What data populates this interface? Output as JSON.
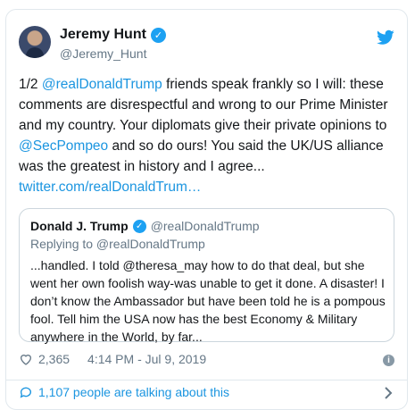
{
  "author": {
    "display_name": "Jeremy Hunt",
    "handle": "@Jeremy_Hunt"
  },
  "tweet": {
    "prefix": "1/2 ",
    "mention1": "@realDonaldTrump",
    "part2": " friends speak frankly so I will: these comments are disrespectful and wrong to our Prime Minister and my country. Your diplomats give their private opinions to ",
    "mention2": "@SecPompeo",
    "part3": " and so do ours! You said the UK/US alliance was the greatest in history and I agree...",
    "link": "twitter.com/realDonaldTrum…"
  },
  "quoted": {
    "display_name": "Donald J. Trump",
    "handle": "@realDonaldTrump",
    "replying_to": "Replying to @realDonaldTrump",
    "text": "...handled. I told @theresa_may how to do that deal, but she went her own foolish way-was unable to get it done. A disaster! I don’t know the Ambassador but have been told he is a pompous fool. Tell him the USA now has the best Economy & Military anywhere in the World, by far..."
  },
  "meta": {
    "likes": "2,365",
    "timestamp": "4:14 PM - Jul 9, 2019"
  },
  "footer": {
    "talking": "1,107 people are talking about this"
  },
  "colors": {
    "accent": "#1da1f2",
    "link": "#1b95e0",
    "muted": "#657786"
  },
  "icons": [
    "verified-badge-icon",
    "twitter-bird-icon",
    "heart-icon",
    "info-icon",
    "comment-bubble-icon",
    "chevron-right-icon"
  ]
}
